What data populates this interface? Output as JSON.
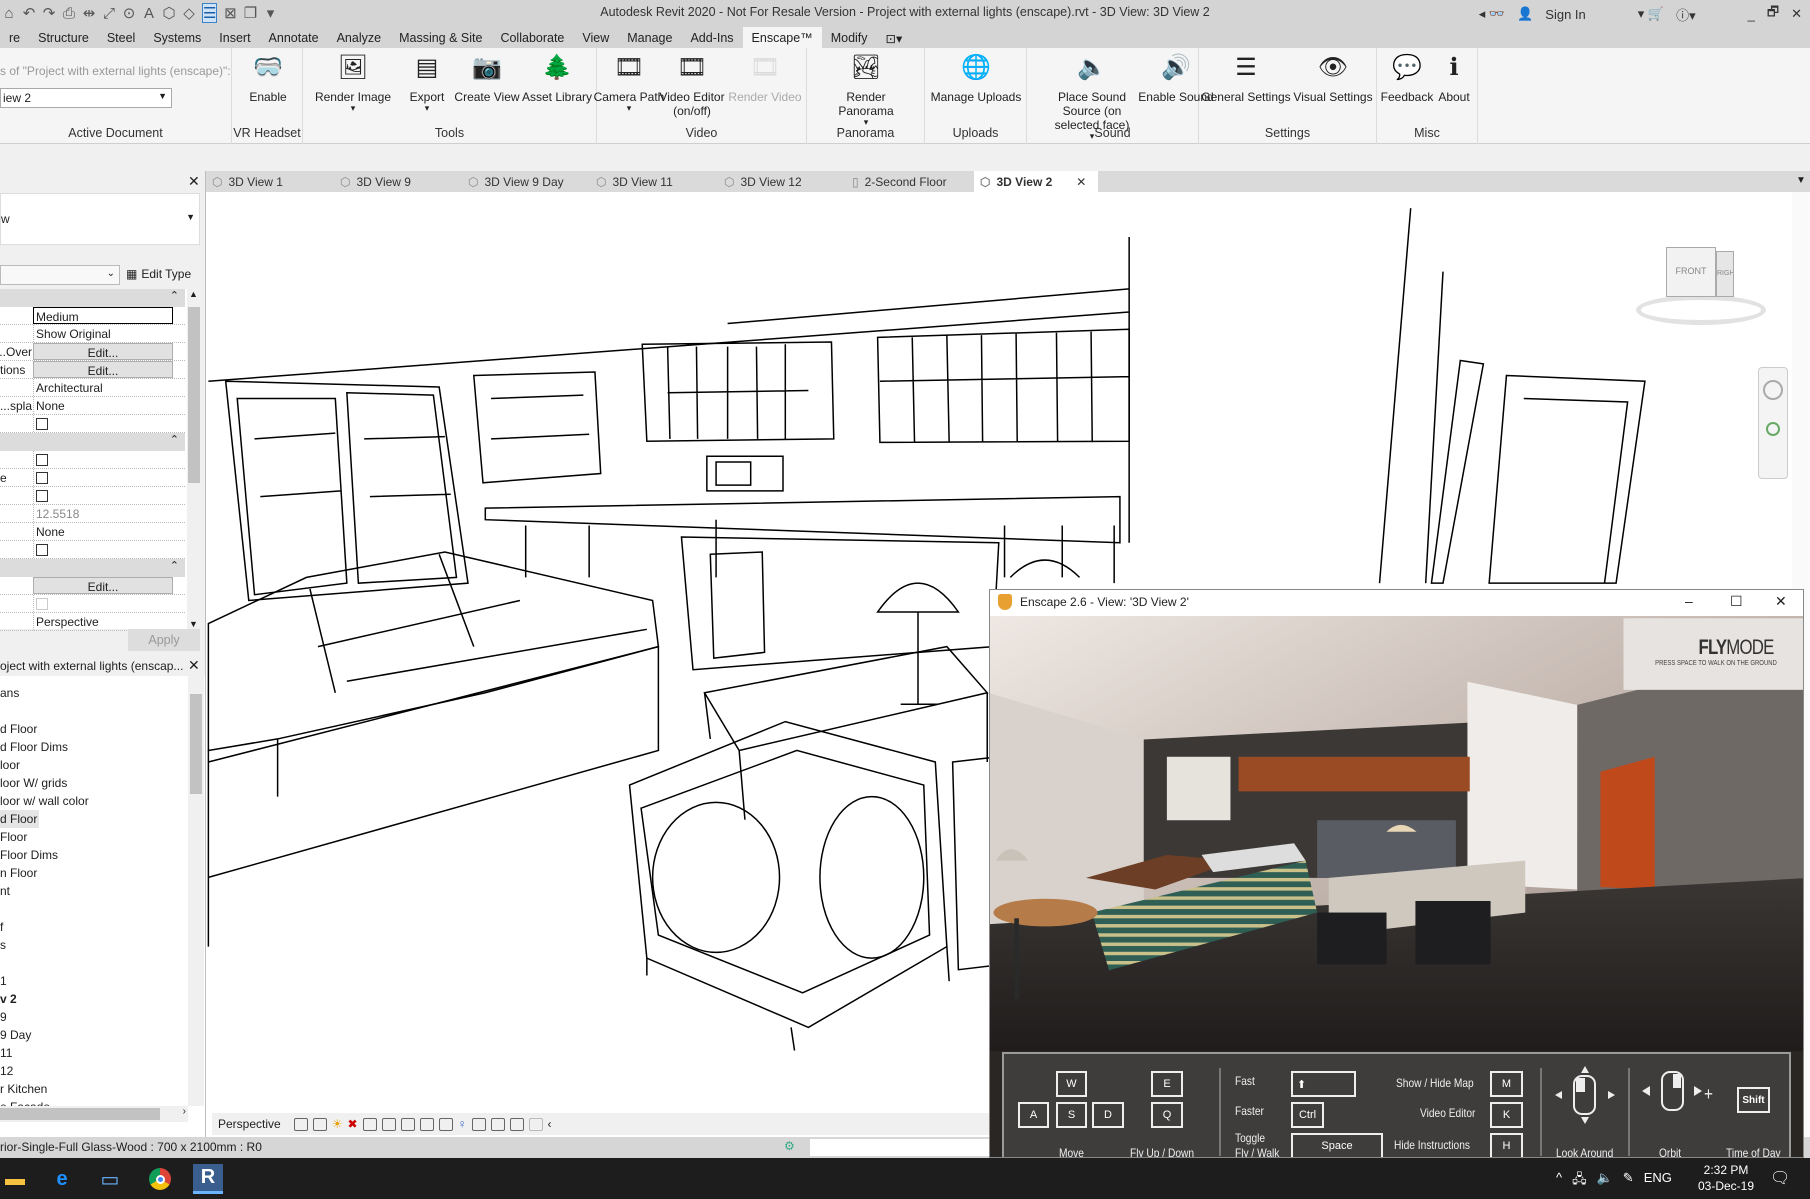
{
  "titlebar": {
    "title": "Autodesk Revit 2020 - Not For Resale Version - Project with external lights (enscape).rvt - 3D View: 3D View 2",
    "sign_in": "Sign In",
    "icons": [
      "binoculars-icon",
      "user-icon",
      "cart-icon",
      "help-icon"
    ],
    "window_controls": [
      "_",
      "🗗",
      "✕"
    ]
  },
  "ribbon_tabs": [
    "re",
    "Structure",
    "Steel",
    "Systems",
    "Insert",
    "Annotate",
    "Analyze",
    "Massing & Site",
    "Collaborate",
    "View",
    "Manage",
    "Add-Ins",
    "Enscape™",
    "Modify"
  ],
  "active_ribbon_tab": "Enscape™",
  "ribbon": {
    "active_document": {
      "caption": "s of \"Project with external lights (enscape)\":",
      "select_value": "iew 2",
      "label": "Active Document"
    },
    "panels": [
      {
        "label": "VR Headset",
        "buttons": [
          {
            "label": "Enable",
            "icon": "vr-headset-icon"
          }
        ]
      },
      {
        "label": "Tools",
        "buttons": [
          {
            "label": "Render Image",
            "icon": "render-image-icon",
            "dropdown": true
          },
          {
            "label": "Export",
            "icon": "export-icon",
            "dropdown": true
          },
          {
            "label": "Create View",
            "icon": "camera-icon"
          },
          {
            "label": "Asset Library",
            "icon": "tree-icon"
          }
        ]
      },
      {
        "label": "Video",
        "buttons": [
          {
            "label": "Camera Path",
            "icon": "filmstrip-icon",
            "dropdown": true
          },
          {
            "label": "Video Editor (on/off)",
            "icon": "video-editor-icon"
          },
          {
            "label": "Render Video",
            "icon": "render-video-icon",
            "disabled": true
          }
        ]
      },
      {
        "label": "Panorama",
        "buttons": [
          {
            "label": "Render Panorama",
            "icon": "panorama-icon",
            "dropdown": true
          }
        ]
      },
      {
        "label": "Uploads",
        "buttons": [
          {
            "label": "Manage Uploads",
            "icon": "globe-icon"
          }
        ]
      },
      {
        "label": "Sound",
        "buttons": [
          {
            "label": "Place Sound Source (on selected face)",
            "icon": "speaker-place-icon",
            "dropdown": true
          },
          {
            "label": "Enable Sound",
            "icon": "speaker-icon"
          }
        ]
      },
      {
        "label": "Settings",
        "buttons": [
          {
            "label": "General Settings",
            "icon": "sliders-icon"
          },
          {
            "label": "Visual Settings",
            "icon": "visual-settings-icon"
          }
        ]
      },
      {
        "label": "Misc",
        "buttons": [
          {
            "label": "Feedback",
            "icon": "feedback-icon"
          },
          {
            "label": "About",
            "icon": "info-icon"
          }
        ]
      }
    ]
  },
  "properties": {
    "type_text": "w",
    "edit_type": "Edit Type",
    "apply": "Apply",
    "rows": [
      {
        "kind": "header"
      },
      {
        "label": "",
        "value": "Medium",
        "kind": "box"
      },
      {
        "label": "",
        "value": "Show Original"
      },
      {
        "label": "Over...",
        "value": "Edit...",
        "kind": "btn"
      },
      {
        "label": "tions",
        "value": "Edit...",
        "kind": "btn"
      },
      {
        "label": "",
        "value": "Architectural"
      },
      {
        "label": "spla...",
        "value": "None"
      },
      {
        "label": "",
        "kind": "check"
      },
      {
        "kind": "header"
      },
      {
        "label": "",
        "kind": "check"
      },
      {
        "label": "e",
        "kind": "check"
      },
      {
        "label": "",
        "kind": "check"
      },
      {
        "label": "",
        "value": "12.5518",
        "kind": "grey"
      },
      {
        "label": "",
        "value": "None"
      },
      {
        "label": "",
        "kind": "check"
      },
      {
        "kind": "header"
      },
      {
        "label": "",
        "value": "Edit...",
        "kind": "btn"
      },
      {
        "label": "",
        "kind": "checkdis"
      },
      {
        "label": "",
        "value": "Perspective"
      }
    ]
  },
  "browser": {
    "title": "oject with external lights (enscap...",
    "items": [
      "ans",
      "",
      "d Floor",
      "d Floor Dims",
      "loor",
      "loor  W/ grids",
      "loor w/ wall color",
      "d Floor",
      "Floor",
      "Floor Dims",
      "n Floor",
      "nt",
      "",
      "f",
      "s",
      "",
      " 1",
      "v 2",
      " 9",
      " 9 Day",
      " 11",
      " 12",
      "r Kitchen",
      "e Facade"
    ],
    "selected_index": 7,
    "bold_index": 17
  },
  "view_tabs": [
    {
      "label": "3D View 1",
      "icon": "3d-view-icon"
    },
    {
      "label": "3D View 9",
      "icon": "3d-view-icon"
    },
    {
      "label": "3D View 9 Day",
      "icon": "3d-view-icon"
    },
    {
      "label": "3D View 11",
      "icon": "3d-view-icon"
    },
    {
      "label": "3D View 12",
      "icon": "3d-view-icon"
    },
    {
      "label": "2-Second Floor",
      "icon": "floor-plan-icon"
    },
    {
      "label": "3D View 2",
      "icon": "3d-view-icon",
      "active": true
    }
  ],
  "viewcube": {
    "front": "FRONT",
    "right": "RIGHT"
  },
  "view_control_bar": {
    "projection": "Perspective"
  },
  "status": {
    "text": "rior-Single-Full Glass-Wood : 700 x 2100mm : R0"
  },
  "enscape": {
    "title": "Enscape 2.6 - View: '3D View 2'",
    "flymode_bold": "FLY",
    "flymode_rest": "MODE",
    "flymode_hint": "PRESS SPACE TO WALK ON THE GROUND",
    "keys": {
      "w": "W",
      "a": "A",
      "s": "S",
      "d": "D",
      "e": "E",
      "q": "Q",
      "fast": "⬆",
      "ctrl": "Ctrl",
      "space": "Space",
      "m": "M",
      "k": "K",
      "h": "H",
      "shift": "Shift",
      "plus": "+"
    },
    "labels": {
      "move": "Move",
      "fly": "Fly Up / Down",
      "fast": "Fast",
      "faster": "Faster",
      "toggle1": "Toggle",
      "toggle2": "Fly / Walk",
      "map": "Show / Hide Map",
      "video": "Video Editor",
      "hide": "Hide Instructions",
      "look": "Look Around",
      "orbit": "Orbit",
      "tod": "Time of Day"
    }
  },
  "taskbar": {
    "apps": [
      "file-explorer-icon",
      "edge-icon",
      "computer-icon",
      "chrome-icon",
      "revit-icon"
    ],
    "lang": "ENG",
    "time": "2:32 PM",
    "date": "03-Dec-19"
  },
  "colors": {
    "accent": "#3b83c9",
    "enscape_orange": "#c8541d"
  }
}
